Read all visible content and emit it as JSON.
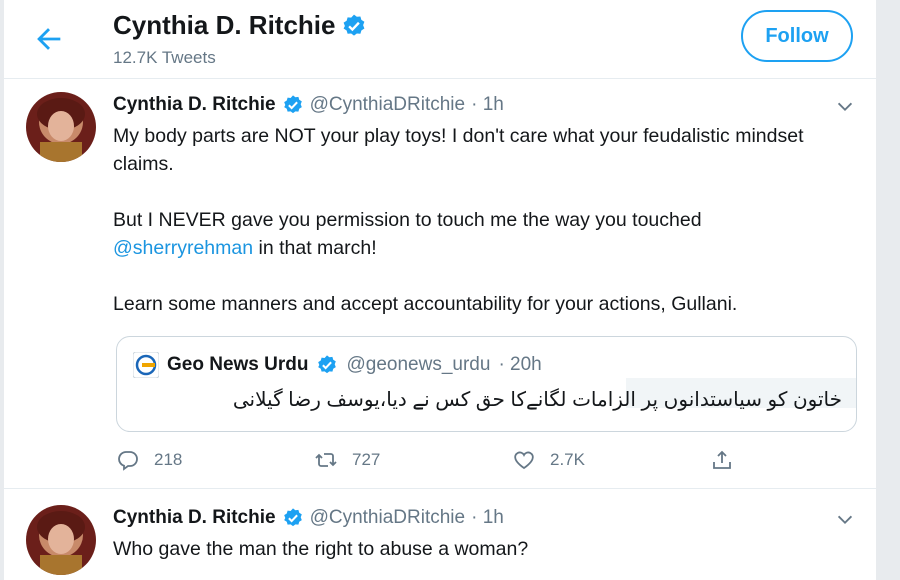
{
  "header": {
    "name": "Cynthia D. Ritchie",
    "tweet_count": "12.7K Tweets",
    "follow_label": "Follow"
  },
  "tweets": [
    {
      "name": "Cynthia D. Ritchie",
      "handle": "@CynthiaDRitchie",
      "time": "· 1h",
      "p1": "My body parts are NOT your play toys! I don't care what your feudalistic mindset claims.",
      "p2_before": "But I NEVER gave you permission to touch me the way you touched",
      "p2_mention": "@sherryrehman",
      "p2_after": " in that march!",
      "p3": "Learn some manners and accept accountability for your actions, Gullani.",
      "quote": {
        "name": "Geo News Urdu",
        "handle": "@geonews_urdu",
        "time": "· 20h",
        "text": "خاتون کو سیاستدانوں پر الزامات لگانےکا حق کس نے دیا،یوسف رضا گیلانی"
      },
      "actions": {
        "replies": "218",
        "retweets": "727",
        "likes": "2.7K"
      }
    },
    {
      "name": "Cynthia D. Ritchie",
      "handle": "@CynthiaDRitchie",
      "time": "· 1h",
      "text": "Who gave the man the right to abuse a woman?"
    }
  ],
  "icons": {
    "back": "arrow-left-icon",
    "verified": "verified-badge-icon",
    "caret": "chevron-down-icon",
    "reply": "reply-icon",
    "retweet": "retweet-icon",
    "like": "heart-icon",
    "share": "share-icon"
  },
  "colors": {
    "accent": "#1da1f2",
    "verified": "#1da1f2",
    "muted": "#657786"
  }
}
